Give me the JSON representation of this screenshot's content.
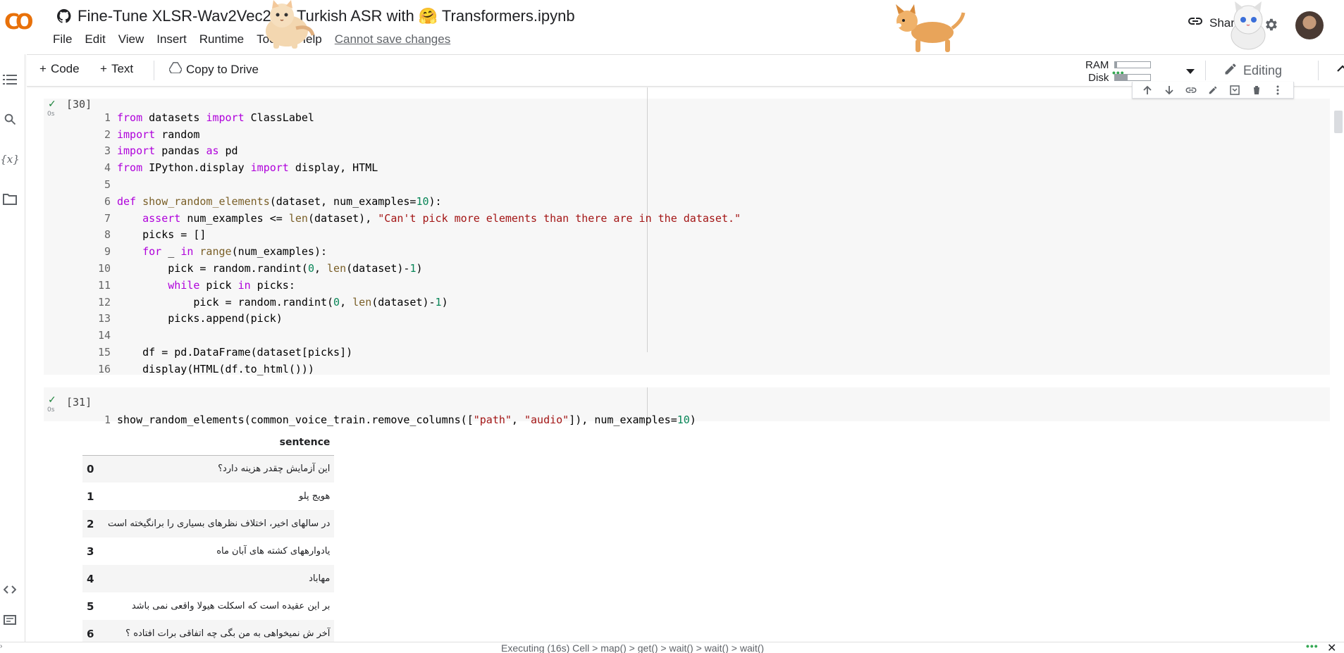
{
  "header": {
    "logo_text": "CO",
    "title": "Fine-Tune XLSR-Wav2Vec2 on Turkish ASR with 🤗 Transformers.ipynb",
    "menu": [
      "File",
      "Edit",
      "View",
      "Insert",
      "Runtime",
      "Tools",
      "Help"
    ],
    "cannot_save": "Cannot save changes",
    "share_label": "Share"
  },
  "toolbar": {
    "code_label": "Code",
    "text_label": "Text",
    "copy_to_drive_label": "Copy to Drive",
    "ram_label": "RAM",
    "disk_label": "Disk",
    "ram_usage": 0.05,
    "disk_usage": 0.35,
    "editing_label": "Editing"
  },
  "cells": [
    {
      "exec_count": "[30]",
      "run_time": "0s",
      "code_lines": [
        "from datasets import ClassLabel",
        "import random",
        "import pandas as pd",
        "from IPython.display import display, HTML",
        "",
        "def show_random_elements(dataset, num_examples=10):",
        "    assert num_examples <= len(dataset), \"Can't pick more elements than there are in the dataset.\"",
        "    picks = []",
        "    for _ in range(num_examples):",
        "        pick = random.randint(0, len(dataset)-1)",
        "        while pick in picks:",
        "            pick = random.randint(0, len(dataset)-1)",
        "        picks.append(pick)",
        "",
        "    df = pd.DataFrame(dataset[picks])",
        "    display(HTML(df.to_html()))"
      ]
    },
    {
      "exec_count": "[31]",
      "run_time": "0s",
      "code_lines": [
        "show_random_elements(common_voice_train.remove_columns([\"path\", \"audio\"]), num_examples=10)"
      ]
    }
  ],
  "output_table": {
    "header": "sentence",
    "rows": [
      {
        "index": "0",
        "sentence": "این آزمایش چقدر هزینه دارد؟"
      },
      {
        "index": "1",
        "sentence": "هویج پلو"
      },
      {
        "index": "2",
        "sentence": "در سالهای اخیر، اختلاف نظرهای بسیاری را برانگیخته است"
      },
      {
        "index": "3",
        "sentence": "یادوارههای کشته های آبان ماه"
      },
      {
        "index": "4",
        "sentence": "مهاباد"
      },
      {
        "index": "5",
        "sentence": "بر این عقیده است که اسکلت هیولا واقعی نمی باشد"
      },
      {
        "index": "6",
        "sentence": "آخر ش نمیخواهی به من بگی چه اتفاقی برات افتاده ؟"
      }
    ]
  },
  "statusbar": {
    "text": "Executing (16s)  Cell > map() > get() > wait() > wait() > wait()"
  },
  "icons": {
    "left_rail": [
      "toc-icon",
      "search-icon",
      "variables-icon",
      "folder-icon",
      "code-snippets-icon",
      "terminal-icon"
    ],
    "cell_toolbar": [
      "move-up-icon",
      "move-down-icon",
      "link-icon",
      "edit-icon",
      "mirror-icon",
      "delete-icon",
      "more-icon"
    ]
  }
}
